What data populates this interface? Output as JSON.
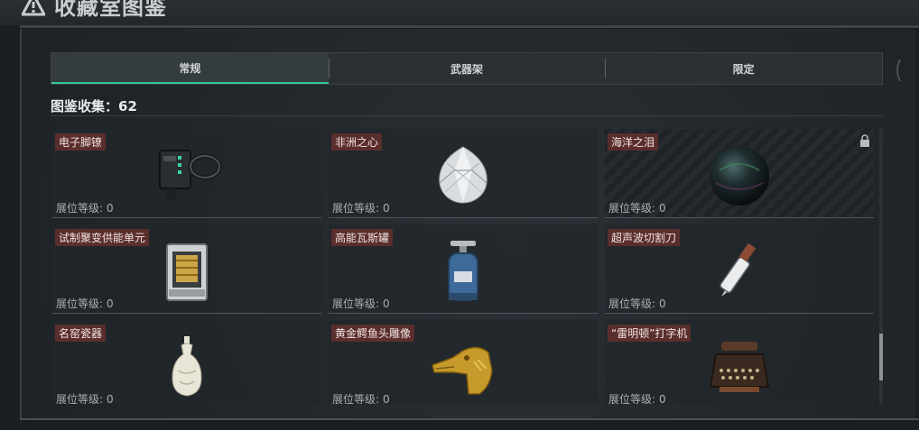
{
  "window": {
    "title": "收藏室图鉴"
  },
  "tabs": [
    {
      "label": "常规",
      "active": true
    },
    {
      "label": "武器架",
      "active": false
    },
    {
      "label": "限定",
      "active": false
    }
  ],
  "collection": {
    "summary": "图鉴收集：62"
  },
  "level_label": "展位等级:",
  "items": [
    {
      "name": "电子脚镣",
      "level": "0",
      "icon": "electronic-shackle-icon",
      "locked": false
    },
    {
      "name": "非洲之心",
      "level": "0",
      "icon": "diamond-icon",
      "locked": false
    },
    {
      "name": "海洋之泪",
      "level": "0",
      "icon": "dark-pearl-icon",
      "locked": true
    },
    {
      "name": "试制聚变供能单元",
      "level": "0",
      "icon": "fusion-cell-icon",
      "locked": false
    },
    {
      "name": "高能瓦斯罐",
      "level": "0",
      "icon": "gas-canister-icon",
      "locked": false
    },
    {
      "name": "超声波切割刀",
      "level": "0",
      "icon": "ultrasonic-knife-icon",
      "locked": false
    },
    {
      "name": "名窑瓷器",
      "level": "0",
      "icon": "porcelain-vase-icon",
      "locked": false
    },
    {
      "name": "黄金鳄鱼头雕像",
      "level": "0",
      "icon": "gold-crocodile-statue-icon",
      "locked": false
    },
    {
      "name": "“雷明顿”打字机",
      "level": "0",
      "icon": "typewriter-icon",
      "locked": false
    }
  ],
  "colors": {
    "accent": "#35c59b",
    "label_bg": "#5a2e2c"
  }
}
